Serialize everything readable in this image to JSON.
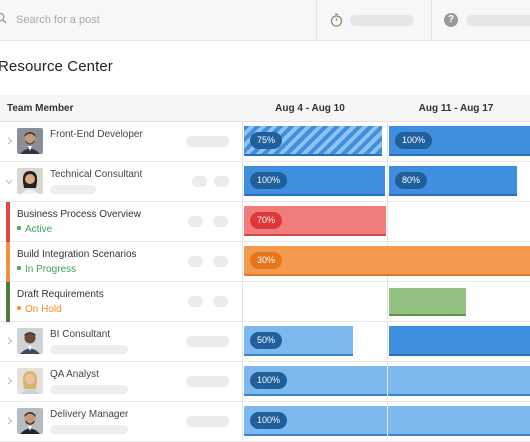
{
  "search": {
    "placeholder": "Search for a post"
  },
  "page": {
    "title": "Resource Center"
  },
  "table": {
    "member_header": "Team Member",
    "weeks": [
      "Aug 4 - Aug 10",
      "Aug 11 - Aug 17"
    ]
  },
  "rows": [
    {
      "kind": "member",
      "name": "Front-End Developer",
      "avatar": "man-beard",
      "bars": [
        {
          "pct": "75%",
          "style": "striped"
        },
        {
          "pct": "100%",
          "style": "dark-blue"
        }
      ]
    },
    {
      "kind": "member",
      "name": "Technical Consultant",
      "avatar": "woman-dark-hair",
      "bars": [
        {
          "pct": "100%",
          "style": "dark-blue"
        },
        {
          "pct": "80%",
          "style": "dark-blue"
        }
      ]
    },
    {
      "kind": "task",
      "name": "Business Process Overview",
      "status": "Active",
      "status_color": "#3aa35a",
      "stripe_color": "#e04848",
      "bars": [
        {
          "pct": "70%",
          "style": "red"
        }
      ]
    },
    {
      "kind": "task",
      "name": "Build Integration Scenarios",
      "status": "In Progress",
      "status_color": "#3aa35a",
      "stripe_color": "#f0913f",
      "bars": [
        {
          "pct": "30%",
          "style": "orange"
        },
        {
          "pct": "",
          "style": "orange"
        }
      ]
    },
    {
      "kind": "task",
      "name": "Draft Requirements",
      "status": "On Hold",
      "status_color": "#ef8a2a",
      "stripe_color": "#4b7e3c",
      "bars": [
        {
          "pct": "",
          "style": "green"
        }
      ]
    },
    {
      "kind": "member",
      "name": "BI Consultant",
      "avatar": "man-dark",
      "bars": [
        {
          "pct": "50%",
          "style": "light-blue"
        },
        {
          "pct": "",
          "style": "dark-blue"
        }
      ]
    },
    {
      "kind": "member",
      "name": "QA Analyst",
      "avatar": "woman-blonde",
      "bars": [
        {
          "pct": "100%",
          "style": "light-blue"
        },
        {
          "pct": "",
          "style": "light-blue"
        }
      ]
    },
    {
      "kind": "member",
      "name": "Delivery Manager",
      "avatar": "man-beard-2",
      "bars": [
        {
          "pct": "100%",
          "style": "light-blue"
        },
        {
          "pct": "",
          "style": "light-blue"
        }
      ]
    }
  ],
  "colors": {
    "accent_blue": "#3f8fde",
    "light_blue": "#7db9ee",
    "red": "#f07c7c",
    "orange": "#f39a4c",
    "green": "#93c181"
  },
  "icons": {
    "search": "search-icon",
    "timer": "timer-icon",
    "help": "help-icon"
  }
}
